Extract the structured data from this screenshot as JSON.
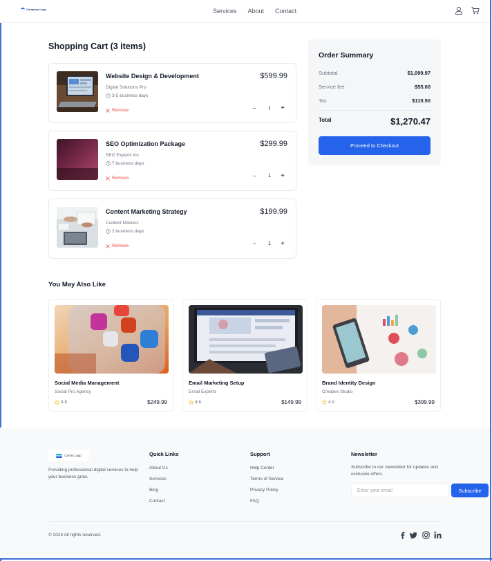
{
  "header": {
    "logo_text": "Company Logo",
    "nav": [
      "Services",
      "About",
      "Contact"
    ],
    "icons": [
      "user-icon",
      "shopping-cart-icon"
    ]
  },
  "cart": {
    "title": "Shopping Cart (3 items)",
    "remove_label": "Remove",
    "items": [
      {
        "name": "Website Design & Development",
        "vendor": "Digital Solutions Pro",
        "duration": "3-5 business days",
        "price": "$599.99",
        "quantity": "1"
      },
      {
        "name": "SEO Optimization Package",
        "vendor": "SEO Experts Inc",
        "duration": "7 business days",
        "price": "$299.99",
        "quantity": "1"
      },
      {
        "name": "Content Marketing Strategy",
        "vendor": "Content Masters",
        "duration": "2 business days",
        "price": "$199.99",
        "quantity": "1"
      }
    ],
    "minus_symbol": "−",
    "plus_symbol": "+"
  },
  "summary": {
    "title": "Order Summary",
    "rows": [
      {
        "label": "Subtotal",
        "value": "$1,099.97"
      },
      {
        "label": "Service fee",
        "value": "$55.00"
      },
      {
        "label": "Tax",
        "value": "$115.50"
      }
    ],
    "total_label": "Total",
    "total_value": "$1,270.47",
    "checkout_label": "Proceed to Checkout"
  },
  "recommendations": {
    "title": "You May Also Like",
    "items": [
      {
        "name": "Social Media Management",
        "vendor": "Social Pro Agency",
        "rating": "4.8",
        "price": "$249.99"
      },
      {
        "name": "Email Marketing Setup",
        "vendor": "Email Experts",
        "rating": "4.6",
        "price": "$149.99"
      },
      {
        "name": "Brand Identity Design",
        "vendor": "Creative Studio",
        "rating": "4.9",
        "price": "$399.99"
      }
    ]
  },
  "footer": {
    "logo_text": "Conny Logo",
    "description": "Providing professional digital services to help your business grow.",
    "quick_links": {
      "title": "Quick Links",
      "links": [
        "About Us",
        "Services",
        "Blog",
        "Contact"
      ]
    },
    "support": {
      "title": "Support",
      "links": [
        "Help Center",
        "Terms of Service",
        "Privacy Policy",
        "FAQ"
      ]
    },
    "newsletter": {
      "title": "Newsletter",
      "description": "Subscribe to our newsletter for updates and exclusive offers.",
      "placeholder": "Enter your email",
      "button_label": "Subscribe"
    },
    "copyright": "© 2024 All rights reserved.",
    "social_icons": [
      "facebook-icon",
      "twitter-icon",
      "instagram-icon",
      "linkedin-icon"
    ]
  },
  "colors": {
    "accent": "#2563eb",
    "danger": "#ef4444",
    "star": "#f5b301",
    "footer_bg": "#f8f9fa"
  }
}
